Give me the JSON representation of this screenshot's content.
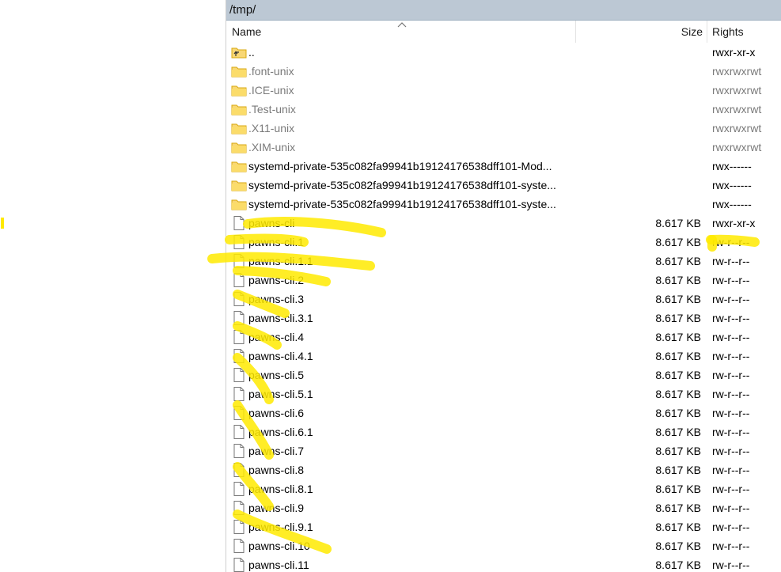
{
  "path": "/tmp/",
  "columns": {
    "name": "Name",
    "size": "Size",
    "rights": "Rights"
  },
  "highlight_color": "#ffea00",
  "rows": [
    {
      "type": "parent",
      "name": "..",
      "size": "",
      "rights": "rwxr-xr-x",
      "hidden": false,
      "icon": "parent-folder-icon"
    },
    {
      "type": "folder",
      "name": ".font-unix",
      "size": "",
      "rights": "rwxrwxrwt",
      "hidden": true,
      "icon": "folder-icon"
    },
    {
      "type": "folder",
      "name": ".ICE-unix",
      "size": "",
      "rights": "rwxrwxrwt",
      "hidden": true,
      "icon": "folder-icon"
    },
    {
      "type": "folder",
      "name": ".Test-unix",
      "size": "",
      "rights": "rwxrwxrwt",
      "hidden": true,
      "icon": "folder-icon"
    },
    {
      "type": "folder",
      "name": ".X11-unix",
      "size": "",
      "rights": "rwxrwxrwt",
      "hidden": true,
      "icon": "folder-icon"
    },
    {
      "type": "folder",
      "name": ".XIM-unix",
      "size": "",
      "rights": "rwxrwxrwt",
      "hidden": true,
      "icon": "folder-icon"
    },
    {
      "type": "folder",
      "name": "systemd-private-535c082fa99941b19124176538dff101-Mod...",
      "size": "",
      "rights": "rwx------",
      "hidden": false,
      "icon": "folder-icon"
    },
    {
      "type": "folder",
      "name": "systemd-private-535c082fa99941b19124176538dff101-syste...",
      "size": "",
      "rights": "rwx------",
      "hidden": false,
      "icon": "folder-icon"
    },
    {
      "type": "folder",
      "name": "systemd-private-535c082fa99941b19124176538dff101-syste...",
      "size": "",
      "rights": "rwx------",
      "hidden": false,
      "icon": "folder-icon"
    },
    {
      "type": "file",
      "name": "pawns-cli",
      "size": "8.617 KB",
      "rights": "rwxr-xr-x",
      "hidden": false,
      "icon": "file-icon"
    },
    {
      "type": "file",
      "name": "pawns-cli.1",
      "size": "8.617 KB",
      "rights": "rw-r--r--",
      "hidden": false,
      "icon": "file-icon"
    },
    {
      "type": "file",
      "name": "pawns-cli.1.1",
      "size": "8.617 KB",
      "rights": "rw-r--r--",
      "hidden": false,
      "icon": "file-icon"
    },
    {
      "type": "file",
      "name": "pawns-cli.2",
      "size": "8.617 KB",
      "rights": "rw-r--r--",
      "hidden": false,
      "icon": "file-icon"
    },
    {
      "type": "file",
      "name": "pawns-cli.3",
      "size": "8.617 KB",
      "rights": "rw-r--r--",
      "hidden": false,
      "icon": "file-icon"
    },
    {
      "type": "file",
      "name": "pawns-cli.3.1",
      "size": "8.617 KB",
      "rights": "rw-r--r--",
      "hidden": false,
      "icon": "file-icon"
    },
    {
      "type": "file",
      "name": "pawns-cli.4",
      "size": "8.617 KB",
      "rights": "rw-r--r--",
      "hidden": false,
      "icon": "file-icon"
    },
    {
      "type": "file",
      "name": "pawns-cli.4.1",
      "size": "8.617 KB",
      "rights": "rw-r--r--",
      "hidden": false,
      "icon": "file-icon"
    },
    {
      "type": "file",
      "name": "pawns-cli.5",
      "size": "8.617 KB",
      "rights": "rw-r--r--",
      "hidden": false,
      "icon": "file-icon"
    },
    {
      "type": "file",
      "name": "pawns-cli.5.1",
      "size": "8.617 KB",
      "rights": "rw-r--r--",
      "hidden": false,
      "icon": "file-icon"
    },
    {
      "type": "file",
      "name": "pawns-cli.6",
      "size": "8.617 KB",
      "rights": "rw-r--r--",
      "hidden": false,
      "icon": "file-icon"
    },
    {
      "type": "file",
      "name": "pawns-cli.6.1",
      "size": "8.617 KB",
      "rights": "rw-r--r--",
      "hidden": false,
      "icon": "file-icon"
    },
    {
      "type": "file",
      "name": "pawns-cli.7",
      "size": "8.617 KB",
      "rights": "rw-r--r--",
      "hidden": false,
      "icon": "file-icon"
    },
    {
      "type": "file",
      "name": "pawns-cli.8",
      "size": "8.617 KB",
      "rights": "rw-r--r--",
      "hidden": false,
      "icon": "file-icon"
    },
    {
      "type": "file",
      "name": "pawns-cli.8.1",
      "size": "8.617 KB",
      "rights": "rw-r--r--",
      "hidden": false,
      "icon": "file-icon"
    },
    {
      "type": "file",
      "name": "pawns-cli.9",
      "size": "8.617 KB",
      "rights": "rw-r--r--",
      "hidden": false,
      "icon": "file-icon"
    },
    {
      "type": "file",
      "name": "pawns-cli.9.1",
      "size": "8.617 KB",
      "rights": "rw-r--r--",
      "hidden": false,
      "icon": "file-icon"
    },
    {
      "type": "file",
      "name": "pawns-cli.10",
      "size": "8.617 KB",
      "rights": "rw-r--r--",
      "hidden": false,
      "icon": "file-icon"
    },
    {
      "type": "file",
      "name": "pawns-cli.11",
      "size": "8.617 KB",
      "rights": "rw-r--r--",
      "hidden": false,
      "icon": "file-icon"
    }
  ]
}
